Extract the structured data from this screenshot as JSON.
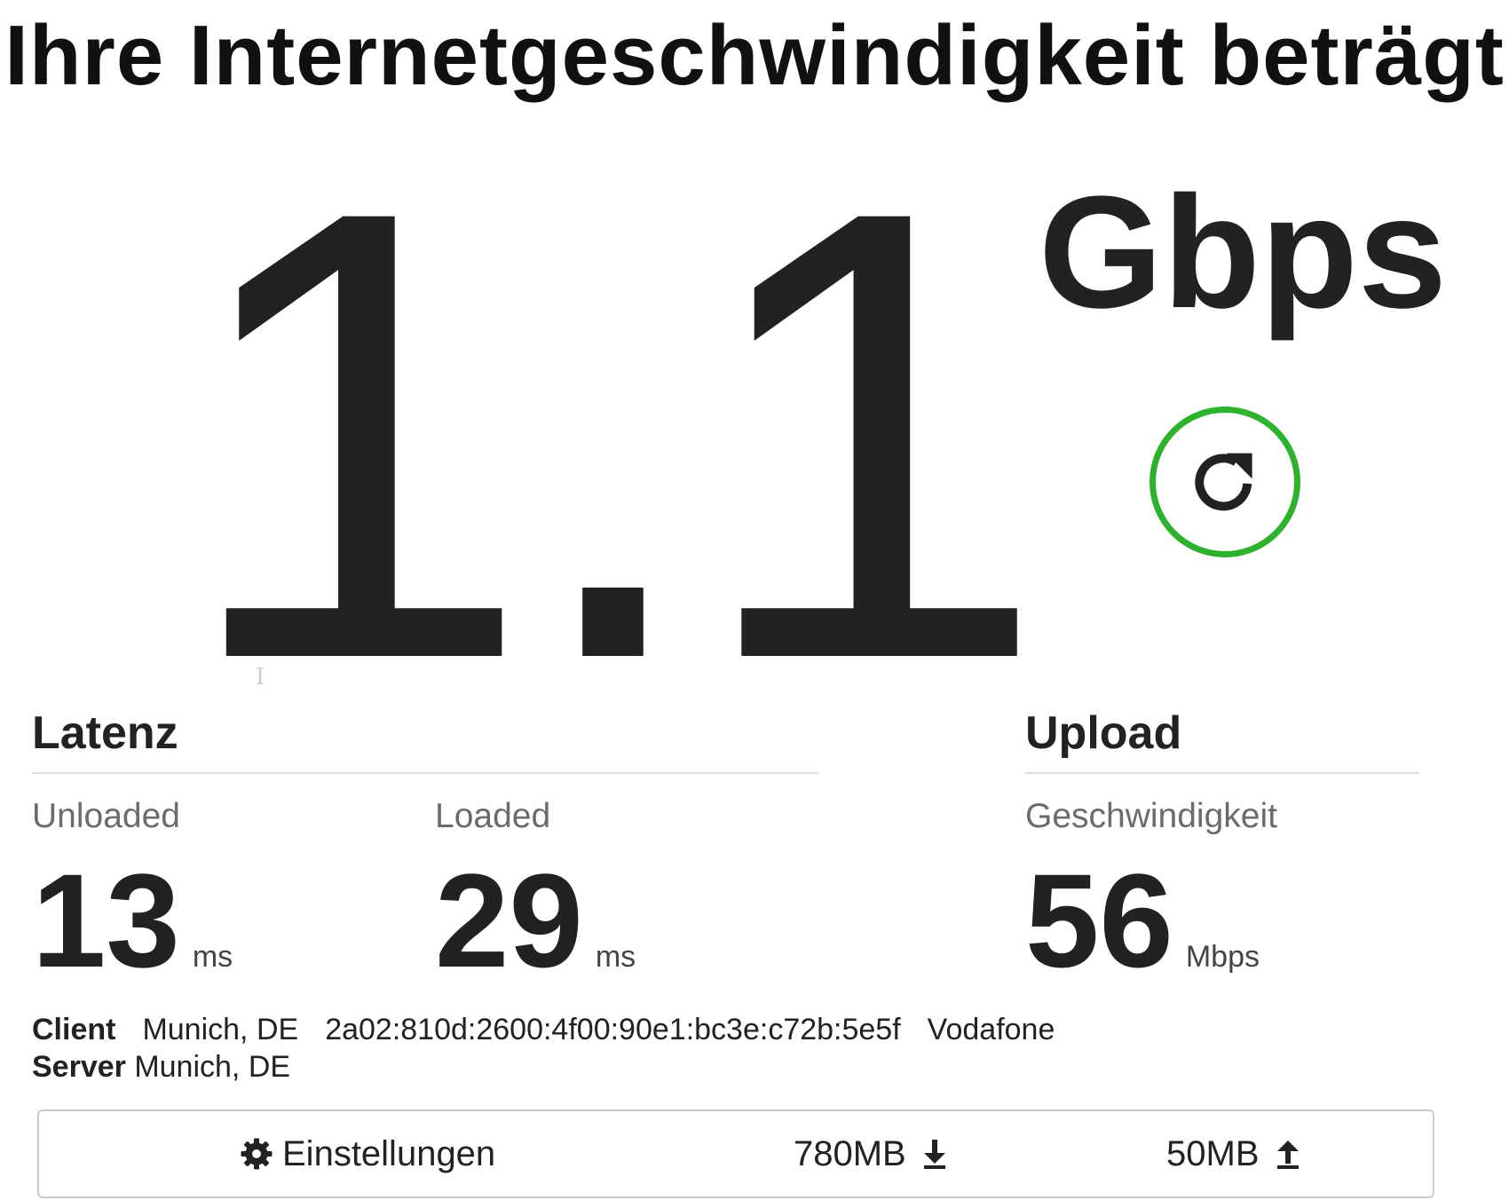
{
  "headline": "Ihre Internetgeschwindigkeit beträgt",
  "download": {
    "value": "1.1",
    "unit": "Gbps"
  },
  "latency": {
    "title": "Latenz",
    "unloaded": {
      "label": "Unloaded",
      "value": "13",
      "unit": "ms"
    },
    "loaded": {
      "label": "Loaded",
      "value": "29",
      "unit": "ms"
    }
  },
  "upload": {
    "title": "Upload",
    "label": "Geschwindigkeit",
    "value": "56",
    "unit": "Mbps"
  },
  "client": {
    "label": "Client",
    "location": "Munich, DE",
    "ip": "2a02:810d:2600:4f00:90e1:bc3e:c72b:5e5f",
    "isp": "Vodafone"
  },
  "server": {
    "label": "Server",
    "location": "Munich, DE"
  },
  "footer": {
    "settings_label": "Einstellungen",
    "download_amount": "780MB",
    "upload_amount": "50MB"
  },
  "colors": {
    "accent_green": "#2db22d",
    "text": "#222222",
    "muted": "#6b6b6b"
  },
  "icons": {
    "retest": "refresh-icon",
    "settings": "gear-icon",
    "download": "download-arrow-icon",
    "upload": "upload-arrow-icon"
  }
}
